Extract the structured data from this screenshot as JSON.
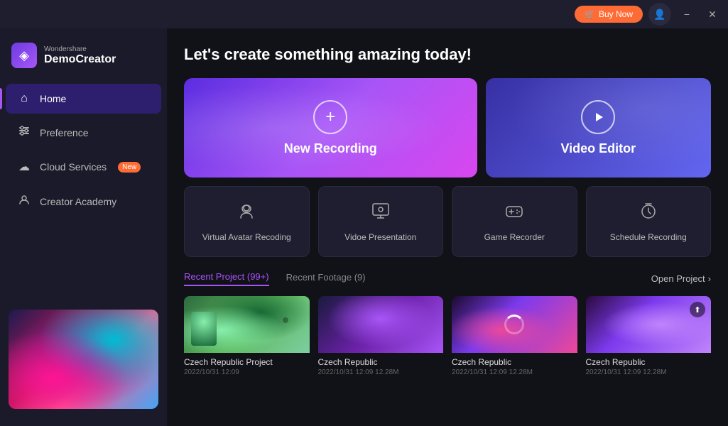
{
  "titleBar": {
    "buyNowLabel": "Buy Now",
    "minimizeLabel": "−",
    "closeLabel": "✕"
  },
  "logo": {
    "brand": "Wondershare",
    "name": "DemoCreator"
  },
  "sidebar": {
    "items": [
      {
        "id": "home",
        "label": "Home",
        "icon": "⌂",
        "active": true
      },
      {
        "id": "preference",
        "label": "Preference",
        "icon": "⊞"
      },
      {
        "id": "cloud",
        "label": "Cloud Services",
        "icon": "☁",
        "badge": "New"
      },
      {
        "id": "academy",
        "label": "Creator Academy",
        "icon": "🎓"
      }
    ]
  },
  "pageTitle": "Let's create something amazing today!",
  "topCards": {
    "newRecording": {
      "label": "New Recording",
      "icon": "+"
    },
    "videoEditor": {
      "label": "Video Editor",
      "icon": "▶"
    }
  },
  "smallCards": [
    {
      "label": "Virtual Avatar Recoding",
      "icon": "👤"
    },
    {
      "label": "Vidoe Presentation",
      "icon": "🖼"
    },
    {
      "label": "Game Recorder",
      "icon": "🎮"
    },
    {
      "label": "Schedule Recording",
      "icon": "⏰"
    }
  ],
  "recentTabs": [
    {
      "label": "Recent Project (99+)",
      "active": true
    },
    {
      "label": "Recent Footage (9)",
      "active": false
    }
  ],
  "openProjectLabel": "Open Project",
  "projects": [
    {
      "name": "Czech Republic Project",
      "date": "2022/10/31 12:09",
      "size": "",
      "thumbClass": "thumb-1",
      "hasAvatar": true,
      "hasUpload": false,
      "hasLoading": false
    },
    {
      "name": "Czech Republic",
      "date": "2022/10/31 12:09",
      "size": "12.28M",
      "thumbClass": "thumb-2",
      "hasAvatar": false,
      "hasUpload": false,
      "hasLoading": false
    },
    {
      "name": "Czech Republic",
      "date": "2022/10/31 12:09",
      "size": "12.28M",
      "thumbClass": "thumb-3",
      "hasAvatar": false,
      "hasUpload": false,
      "hasLoading": true
    },
    {
      "name": "Czech Republic",
      "date": "2022/10/31 12:09",
      "size": "12.28M",
      "thumbClass": "thumb-4",
      "hasAvatar": false,
      "hasUpload": true,
      "hasLoading": false
    }
  ]
}
